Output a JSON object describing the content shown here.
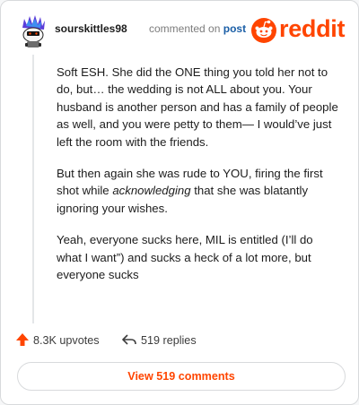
{
  "header": {
    "username": "sourskittles98",
    "commented_on": "commented on",
    "post_link": "post",
    "logo_text": "reddit"
  },
  "comment": {
    "paragraphs": [
      {
        "before": "Soft ESH. She did the ONE thing you told her not to do, but… the wedding is not ALL about you. Your husband is another person and has a family of people as well, and you were petty to them— I would’ve just left the room with the friends.",
        "em": "",
        "after": ""
      },
      {
        "before": "But then again she was rude to YOU, firing the first shot while ",
        "em": "acknowledging",
        "after": " that she was blatantly ignoring your wishes."
      },
      {
        "before": "Yeah, everyone sucks here, MIL is entitled (I’ll do what I want”) and sucks a heck of a lot more, but everyone sucks",
        "em": "",
        "after": ""
      }
    ]
  },
  "actions": {
    "upvotes": "8.3K upvotes",
    "replies": "519 replies"
  },
  "footer": {
    "view_comments": "View 519 comments"
  },
  "colors": {
    "brand": "#ff4500",
    "link": "#1a5ea6",
    "muted": "#7c7c7c"
  },
  "icons": {
    "avatar": "snoo-avatar-icon",
    "logo": "reddit-logo-icon",
    "upvote": "upvote-arrow-icon",
    "reply": "reply-arrow-icon"
  }
}
